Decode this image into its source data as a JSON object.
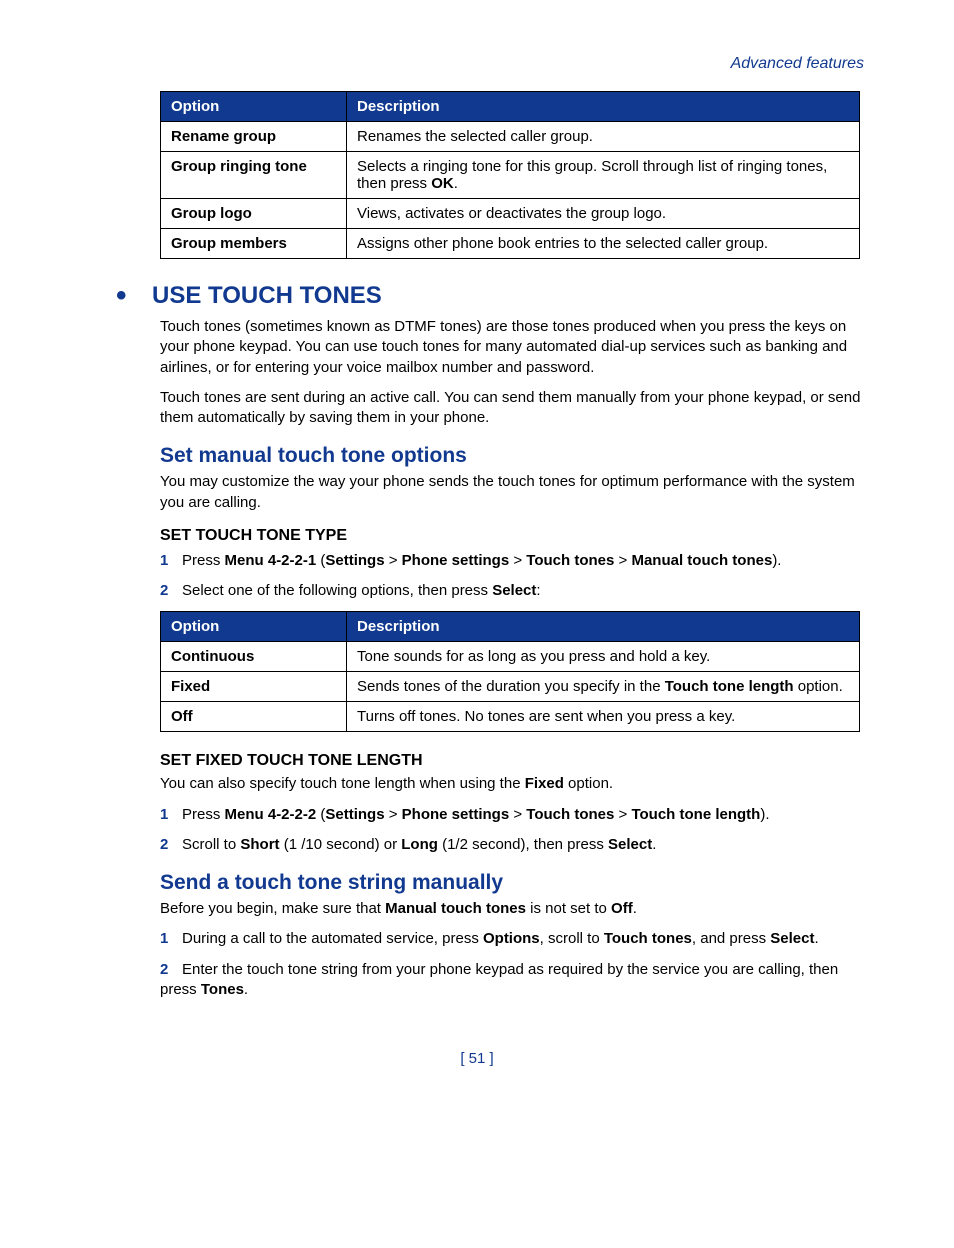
{
  "header": {
    "section": "Advanced features"
  },
  "table1": {
    "h_option": "Option",
    "h_desc": "Description",
    "rows": [
      {
        "opt": "Rename group",
        "desc": "Renames the selected caller group."
      },
      {
        "opt": "Group ringing tone",
        "desc_pre": "Selects a ringing tone for this group. Scroll through list of ringing tones, then press ",
        "desc_b": "OK",
        "desc_post": "."
      },
      {
        "opt": "Group logo",
        "desc": "Views, activates or deactivates the group logo."
      },
      {
        "opt": "Group members",
        "desc": "Assigns other phone book entries to the selected caller group."
      }
    ]
  },
  "h1": "USE TOUCH TONES",
  "p1": "Touch tones (sometimes known as DTMF tones) are those tones produced when you press the keys on your phone keypad. You can use touch tones for many automated dial-up services such as banking and airlines, or for entering your voice mailbox number and password.",
  "p2": "Touch tones are sent during an active call. You can send them manually from your phone keypad, or send them automatically by saving them in your phone.",
  "h2a": "Set manual touch tone options",
  "p3": "You may customize the way your phone sends the touch tones for optimum performance with the system you are calling.",
  "h3a": "SET TOUCH TONE TYPE",
  "step1a": {
    "pre": "Press ",
    "b1": "Menu 4-2-2-1",
    "mid1": " (",
    "b2": "Settings",
    "gt1": " > ",
    "b3": "Phone settings",
    "gt2": " > ",
    "b4": "Touch tones",
    "gt3": " > ",
    "b5": "Manual touch tones",
    "post": ")."
  },
  "step2a": {
    "pre": "Select one of the following options, then press ",
    "b1": "Select",
    "post": ":"
  },
  "table2": {
    "h_option": "Option",
    "h_desc": "Description",
    "rows": [
      {
        "opt": "Continuous",
        "desc": "Tone sounds for as long as you press and hold a key."
      },
      {
        "opt": "Fixed",
        "desc_pre": "Sends tones of the duration you specify in the ",
        "desc_b": "Touch tone length",
        "desc_post": " option."
      },
      {
        "opt": "Off",
        "desc": "Turns off tones. No tones are sent when you press a key."
      }
    ]
  },
  "h3b": "SET FIXED TOUCH TONE LENGTH",
  "p4": {
    "pre": "You can also specify touch tone length when using the ",
    "b": "Fixed",
    "post": " option."
  },
  "step1b": {
    "pre": "Press ",
    "b1": "Menu 4-2-2-2",
    "mid1": " (",
    "b2": "Settings",
    "gt1": " > ",
    "b3": "Phone settings",
    "gt2": " > ",
    "b4": "Touch tones",
    "gt3": " > ",
    "b5": "Touch tone length",
    "post": ")."
  },
  "step2b": {
    "pre": "Scroll to ",
    "b1": "Short",
    "mid1": " (1 /10 second) or ",
    "b2": "Long",
    "mid2": " (1/2 second), then press ",
    "b3": "Select",
    "post": "."
  },
  "h2b": "Send a touch tone string manually",
  "p5": {
    "pre": "Before you begin, make sure that ",
    "b1": "Manual touch tones",
    "mid": " is not set to ",
    "b2": "Off",
    "post": "."
  },
  "step1c": {
    "pre": "During a call to the automated service, press ",
    "b1": "Options",
    "mid1": ", scroll to ",
    "b2": "Touch tones",
    "mid2": ", and press ",
    "b3": "Select",
    "post": "."
  },
  "step2c": {
    "pre": "Enter the touch tone string from your phone keypad as required by the service you are calling, then press ",
    "b1": "Tones",
    "post": "."
  },
  "footer": "[ 51 ]"
}
